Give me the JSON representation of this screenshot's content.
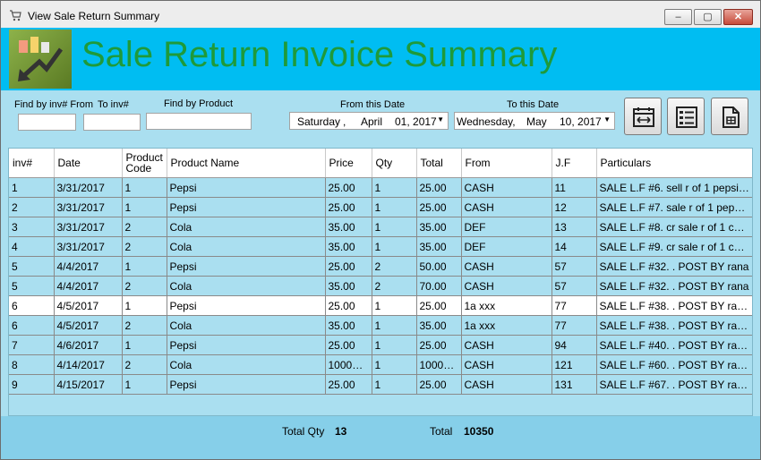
{
  "window": {
    "title": "View Sale Return Summary",
    "minimize": "–",
    "maximize": "▢",
    "close": "✕"
  },
  "banner": {
    "title": "Sale Return Invoice Summary"
  },
  "filters": {
    "find_inv_from_label": "Find by inv# From",
    "to_inv_label": "To inv#",
    "find_product_label": "Find by Product",
    "from_date_label": "From this Date",
    "to_date_label": "To this Date",
    "from_date": {
      "weekday": "Saturday",
      "sep": ",",
      "month": "April",
      "day_year": "01, 2017"
    },
    "to_date": {
      "weekday": "Wednesday,",
      "month": "May",
      "day_year": "10, 2017"
    }
  },
  "toolbar": [
    {
      "icon": "calendar-range-icon"
    },
    {
      "icon": "list-icon"
    },
    {
      "icon": "document-icon"
    }
  ],
  "table": {
    "columns": [
      "inv#",
      "Date",
      "Product Code",
      "Product Name",
      "Price",
      "Qty",
      "Total",
      "From",
      "J.F",
      "Particulars"
    ],
    "rows": [
      [
        "1",
        "3/31/2017",
        "1",
        "Pepsi",
        "25.00",
        "1",
        "25.00",
        "CASH",
        "11",
        "SALE L.F #6. sell r of 1 pepsi 25 ..."
      ],
      [
        "2",
        "3/31/2017",
        "1",
        "Pepsi",
        "25.00",
        "1",
        "25.00",
        "CASH",
        "12",
        "SALE L.F #7. sale r of 1 pepsi 25 ..."
      ],
      [
        "3",
        "3/31/2017",
        "2",
        "Cola",
        "35.00",
        "1",
        "35.00",
        "DEF",
        "13",
        "SALE L.F #8. cr sale r of 1 cola 3..."
      ],
      [
        "4",
        "3/31/2017",
        "2",
        "Cola",
        "35.00",
        "1",
        "35.00",
        "DEF",
        "14",
        "SALE L.F #9. cr sale r of 1 cola 3..."
      ],
      [
        "5",
        "4/4/2017",
        "1",
        "Pepsi",
        "25.00",
        "2",
        "50.00",
        "CASH",
        "57",
        "SALE L.F #32. . POST BY rana"
      ],
      [
        "5",
        "4/4/2017",
        "2",
        "Cola",
        "35.00",
        "2",
        "70.00",
        "CASH",
        "57",
        "SALE L.F #32. . POST BY rana"
      ],
      [
        "6",
        "4/5/2017",
        "1",
        "Pepsi",
        "25.00",
        "1",
        "25.00",
        "1a xxx",
        "77",
        "SALE L.F #38. . POST BY rana. ..."
      ],
      [
        "6",
        "4/5/2017",
        "2",
        "Cola",
        "35.00",
        "1",
        "35.00",
        "1a xxx",
        "77",
        "SALE L.F #38. . POST BY rana. ..."
      ],
      [
        "7",
        "4/6/2017",
        "1",
        "Pepsi",
        "25.00",
        "1",
        "25.00",
        "CASH",
        "94",
        "SALE L.F #40. . POST BY rana. ..."
      ],
      [
        "8",
        "4/14/2017",
        "2",
        "Cola",
        "10000....",
        "1",
        "10000....",
        "CASH",
        "121",
        "SALE L.F #60. . POST BY rana. ..."
      ],
      [
        "9",
        "4/15/2017",
        "1",
        "Pepsi",
        "25.00",
        "1",
        "25.00",
        "CASH",
        "131",
        "SALE L.F #67. . POST BY rana. ..."
      ]
    ],
    "selected_row": 6
  },
  "footer": {
    "total_qty_label": "Total Qty",
    "total_qty": "13",
    "total_label": "Total",
    "total": "10350"
  }
}
